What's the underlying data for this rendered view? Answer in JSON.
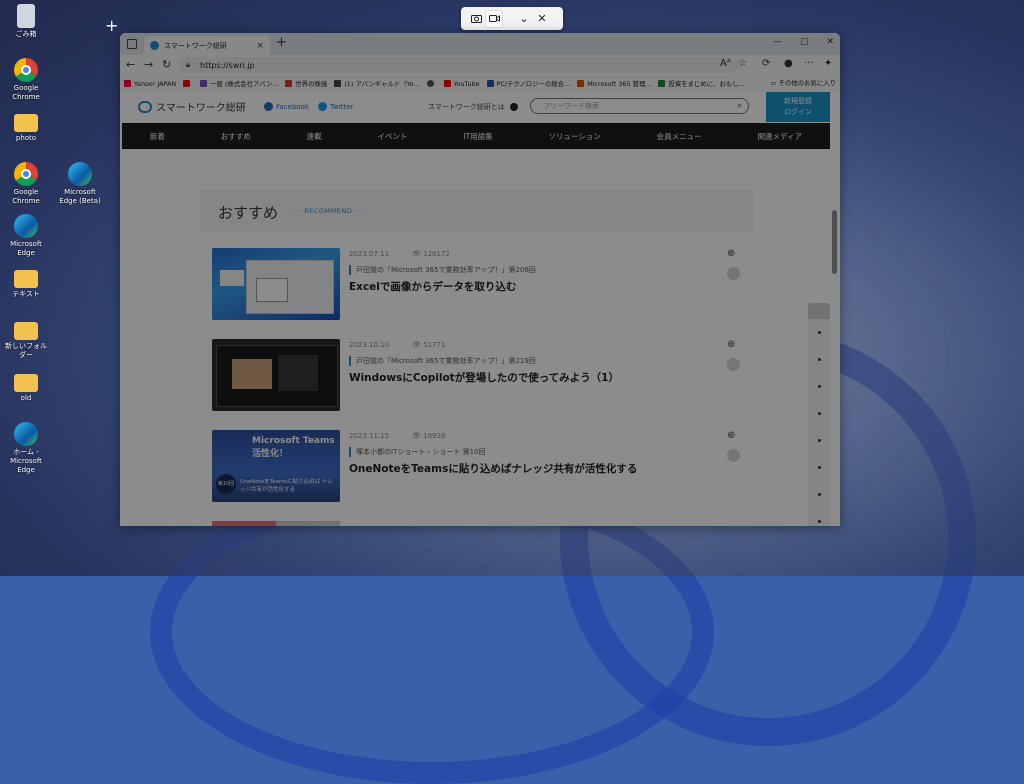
{
  "desktop": {
    "icons": [
      {
        "label": "ごみ箱",
        "type": "recycle"
      },
      {
        "label": "Google Chrome",
        "type": "chrome"
      },
      {
        "label": "photo",
        "type": "folder"
      },
      {
        "label": "Google Chrome",
        "type": "chrome"
      },
      {
        "label": "Microsoft Edge",
        "type": "edge"
      },
      {
        "label": "テキスト",
        "type": "folder"
      },
      {
        "label": "新しいフォルダー",
        "type": "folder"
      },
      {
        "label": "old",
        "type": "folder"
      },
      {
        "label": "ホーム - Microsoft Edge",
        "type": "edge"
      },
      {
        "label": "Microsoft Edge (Beta)",
        "type": "edge"
      }
    ]
  },
  "snipping_toolbar": {
    "buttons": [
      "camera-icon",
      "video-icon",
      "chevron-down-icon",
      "close-icon"
    ],
    "close_glyph": "✕",
    "chevron_glyph": "⌄"
  },
  "browser": {
    "tab_title": "スマートワーク総研",
    "url": "https://swri.jp",
    "bookmarks": [
      {
        "label": "Yahoo! JAPAN",
        "color": "#ff0033"
      },
      {
        "label": "",
        "color": "#ff0000"
      },
      {
        "label": "一般 (株式会社アバン...",
        "color": "#7b4bc2"
      },
      {
        "label": "世界の株価",
        "color": "#d33"
      },
      {
        "label": "(1) アバンギャルド（Yo...",
        "color": "#444"
      },
      {
        "label": "",
        "color": "#555"
      },
      {
        "label": "YouTube",
        "color": "#ff0000"
      },
      {
        "label": "PC/テクノロジーの総合...",
        "color": "#1f56b3"
      },
      {
        "label": "Microsoft 365 管理...",
        "color": "#e65100"
      },
      {
        "label": "投資をまじめに、おもし...",
        "color": "#1a8a3a"
      }
    ],
    "bookmarks_other": "その他のお気に入り"
  },
  "site": {
    "logo": "スマートワーク総研",
    "facebook": "Facebook",
    "twitter": "Twitter",
    "about": "スマートワーク総研とは",
    "search_placeholder": "フリーワード検索",
    "login_line1": "新規登録",
    "login_line2": "ログイン",
    "nav": [
      "新着",
      "おすすめ",
      "連載",
      "イベント",
      "IT用語集",
      "ソリューション",
      "会員メニュー",
      "関連メディア"
    ],
    "section_title": "おすすめ",
    "section_sub": "··· RECOMMEND ···"
  },
  "articles": [
    {
      "date": "2023.07.11",
      "views": "128172",
      "series": "戸田覚の「Microsoft 365で業務効率アップ！」第206回",
      "title": "Excelで画像からデータを取り込む"
    },
    {
      "date": "2023.10.10",
      "views": "51771",
      "series": "戸田覚の「Microsoft 365で業務効率アップ！」第219回",
      "title": "WindowsにCopilotが登場したので使ってみよう（1）"
    },
    {
      "date": "2023.11.15",
      "views": "18926",
      "series": "塚本小都のITショート・ショート 第10回",
      "title": "OneNoteをTeamsに貼り込めばナレッジ共有が活性化する"
    }
  ],
  "thumb_texts": {
    "third_badge": "第10回",
    "third_caption": "OneNoteをTeamsに貼り込めば ナレッジ共有が活性化する",
    "third_head": "Microsoft Teams 活性化！"
  }
}
